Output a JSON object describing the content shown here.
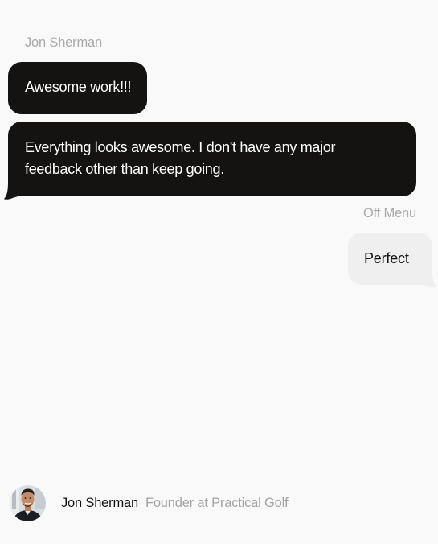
{
  "conversation": {
    "incoming": {
      "sender": "Jon Sherman",
      "messages": [
        "Awesome work!!!",
        "Everything looks awesome. I don't have any major feedback other than keep going."
      ]
    },
    "outgoing": {
      "sender": "Off Menu",
      "messages": [
        "Perfect"
      ]
    }
  },
  "testimonial": {
    "author_name": "Jon Sherman",
    "author_role": "Founder at Practical Golf",
    "avatar_icon": "avatar-photo"
  },
  "colors": {
    "background": "#f9f9f9",
    "dark_bubble": "#141311",
    "light_bubble": "#efefef",
    "muted_text": "#a9a9a9"
  }
}
